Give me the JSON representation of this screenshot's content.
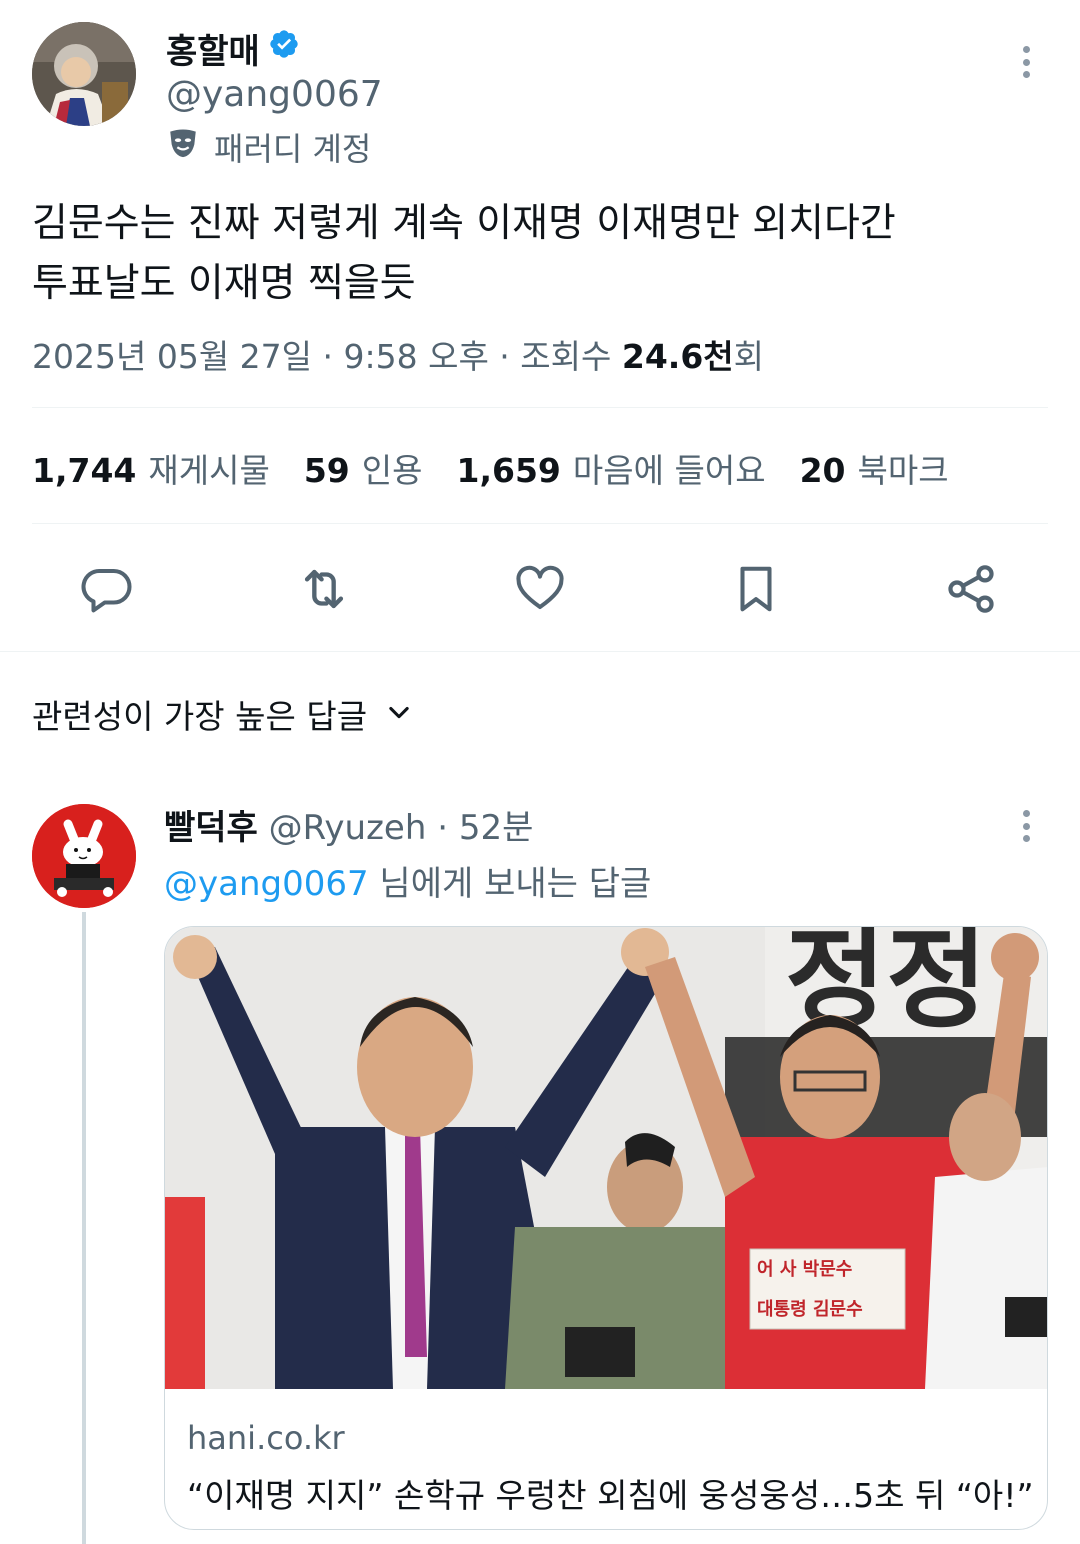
{
  "author": {
    "display_name": "홍할매",
    "handle": "@yang0067",
    "parody_label": "패러디 계정",
    "verified": true
  },
  "tweet": {
    "text_line1": "김문수는 진짜 저렇게 계속 이재명 이재명만 외치다간",
    "text_line2": "투표날도 이재명 찍을듯",
    "timestamp": "2025년 05월 27일 · 9:58 오후 · 조회수 ",
    "views_bold": "24.6천",
    "views_suffix": "회"
  },
  "stats": [
    {
      "num": "1,744",
      "label": "재게시물"
    },
    {
      "num": "59",
      "label": "인용"
    },
    {
      "num": "1,659",
      "label": "마음에 들어요"
    },
    {
      "num": "20",
      "label": "북마크"
    }
  ],
  "actions": [
    "reply-icon",
    "retweet-icon",
    "like-icon",
    "bookmark-icon",
    "share-icon"
  ],
  "sort_label": "관련성이 가장 높은 답글",
  "reply": {
    "display_name": "빨덕후",
    "handle_time": " @Ryuzeh · 52분",
    "mention": "@yang0067",
    "reply_suffix": " 님에게 보내는 답글",
    "card": {
      "image_text_banner": "정정",
      "sign_line1": "어 사 박문수",
      "sign_line2": "대통령 김문수",
      "domain": "hani.co.kr",
      "title": "“이재명 지지” 손학규 우렁찬 외침에 웅성웅성…5초 뒤 “아!”"
    }
  },
  "colors": {
    "accent": "#1d9bf0",
    "secondary_text": "#536471",
    "primary_text": "#0f1419"
  }
}
